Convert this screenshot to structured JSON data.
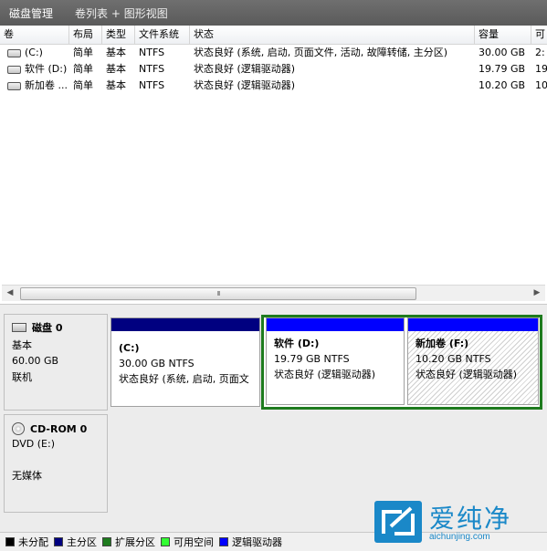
{
  "window": {
    "title": "磁盘管理",
    "subtitle": "卷列表 + 图形视图"
  },
  "table": {
    "columns": [
      "卷",
      "布局",
      "类型",
      "文件系统",
      "状态",
      "容量",
      "可"
    ],
    "rows": [
      {
        "volume": "(C:)",
        "layout": "简单",
        "type": "基本",
        "fs": "NTFS",
        "status": "状态良好 (系统, 启动, 页面文件, 活动, 故障转储, 主分区)",
        "capacity": "30.00 GB",
        "free": "2:"
      },
      {
        "volume": "软件 (D:)",
        "layout": "简单",
        "type": "基本",
        "fs": "NTFS",
        "status": "状态良好 (逻辑驱动器)",
        "capacity": "19.79 GB",
        "free": "19"
      },
      {
        "volume": "新加卷 ...",
        "layout": "简单",
        "type": "基本",
        "fs": "NTFS",
        "status": "状态良好 (逻辑驱动器)",
        "capacity": "10.20 GB",
        "free": "10"
      }
    ]
  },
  "scrollbar": {
    "grip": "III"
  },
  "disks": [
    {
      "name": "磁盘 0",
      "type": "基本",
      "size": "60.00 GB",
      "state": "联机",
      "partitions": [
        {
          "name": "(C:)",
          "size": "30.00 GB NTFS",
          "status": "状态良好 (系统, 启动, 页面文",
          "bar_color": "#000080"
        },
        {
          "name": "软件  (D:)",
          "size": "19.79 GB NTFS",
          "status": "状态良好 (逻辑驱动器)",
          "bar_color": "#0000ff"
        },
        {
          "name": "新加卷  (F:)",
          "size": "10.20 GB NTFS",
          "status": "状态良好 (逻辑驱动器)",
          "bar_color": "#0000ff"
        }
      ]
    },
    {
      "name": "CD-ROM 0",
      "type": "DVD (E:)",
      "state": "无媒体"
    }
  ],
  "legend": [
    {
      "label": "未分配",
      "color": "#000000"
    },
    {
      "label": "主分区",
      "color": "#000080"
    },
    {
      "label": "扩展分区",
      "color": "#1e7b1e"
    },
    {
      "label": "可用空间",
      "color": "#33ff33"
    },
    {
      "label": "逻辑驱动器",
      "color": "#0000ff"
    }
  ],
  "watermark": {
    "text": "爱纯净",
    "url": "aichunjing.com"
  }
}
